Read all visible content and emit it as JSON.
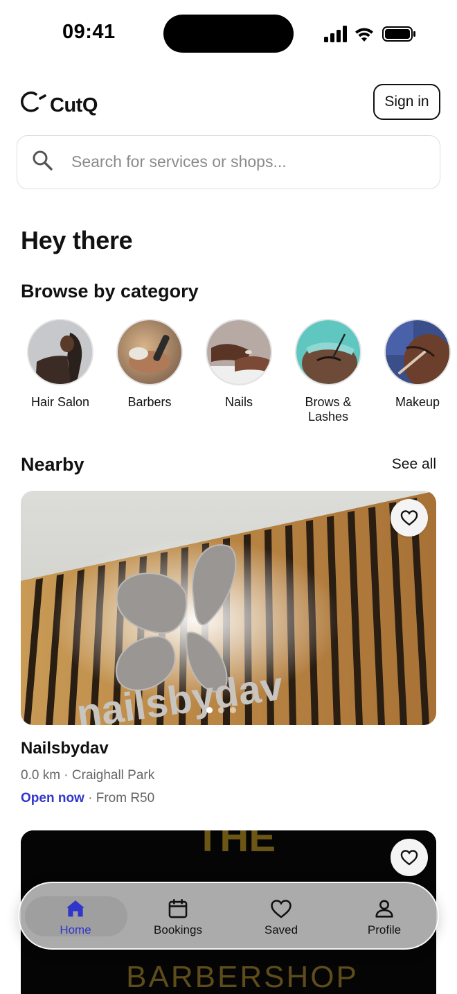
{
  "status_bar": {
    "time": "09:41"
  },
  "header": {
    "logo_text": "CutQ",
    "sign_in_label": "Sign in"
  },
  "search": {
    "placeholder": "Search for services or shops..."
  },
  "greeting": "Hey there",
  "categories": {
    "title": "Browse by category",
    "items": [
      {
        "label": "Hair Salon"
      },
      {
        "label": "Barbers"
      },
      {
        "label": "Nails"
      },
      {
        "label": "Brows &\nLashes"
      },
      {
        "label": "Makeup"
      }
    ]
  },
  "nearby": {
    "title": "Nearby",
    "see_all_label": "See all",
    "shops": [
      {
        "name": "Nailsbydav",
        "distance": "0.0 km",
        "area": "Craighall Park",
        "status": "Open now",
        "price": "From R50",
        "image_text": "nailsbydav",
        "carousel_count": 3,
        "carousel_active": 1
      },
      {
        "image_text_top": "THE",
        "image_text_bottom": "BARBERSHOP"
      }
    ]
  },
  "bottom_nav": {
    "items": [
      {
        "label": "Home",
        "icon": "home-icon",
        "active": true
      },
      {
        "label": "Bookings",
        "icon": "calendar-icon",
        "active": false
      },
      {
        "label": "Saved",
        "icon": "heart-icon",
        "active": false
      },
      {
        "label": "Profile",
        "icon": "person-icon",
        "active": false
      }
    ]
  },
  "colors": {
    "accent": "#2f36c9",
    "text": "#111111",
    "muted": "#666666"
  }
}
